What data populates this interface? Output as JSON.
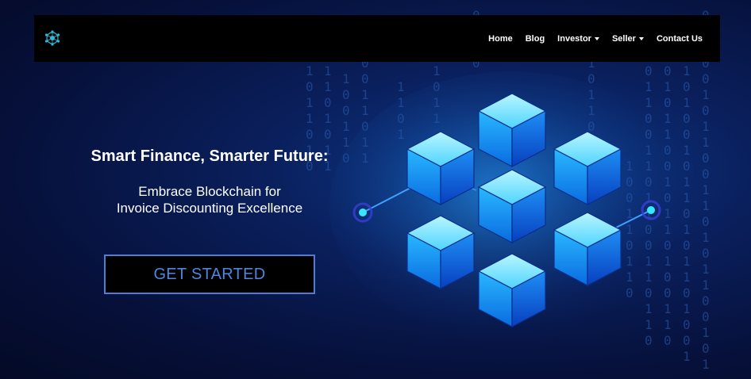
{
  "header": {
    "logo_icon": "blockchain-network-icon",
    "nav_items": [
      {
        "label": "Home",
        "has_dropdown": false
      },
      {
        "label": "Blog",
        "has_dropdown": false
      },
      {
        "label": "Investor",
        "has_dropdown": true
      },
      {
        "label": "Seller",
        "has_dropdown": true
      },
      {
        "label": "Contact Us",
        "has_dropdown": false
      }
    ]
  },
  "hero": {
    "title": "Smart Finance, Smarter Future:",
    "subtitle_line1": "Embrace Blockchain for",
    "subtitle_line2": "Invoice Discounting Excellence",
    "cta_label": "GET STARTED"
  },
  "colors": {
    "background": "#06103a",
    "navbar": "#000000",
    "accent": "#4a7fd6",
    "cube_light": "#7fe9ff",
    "cube_dark": "#0a4fd0"
  }
}
